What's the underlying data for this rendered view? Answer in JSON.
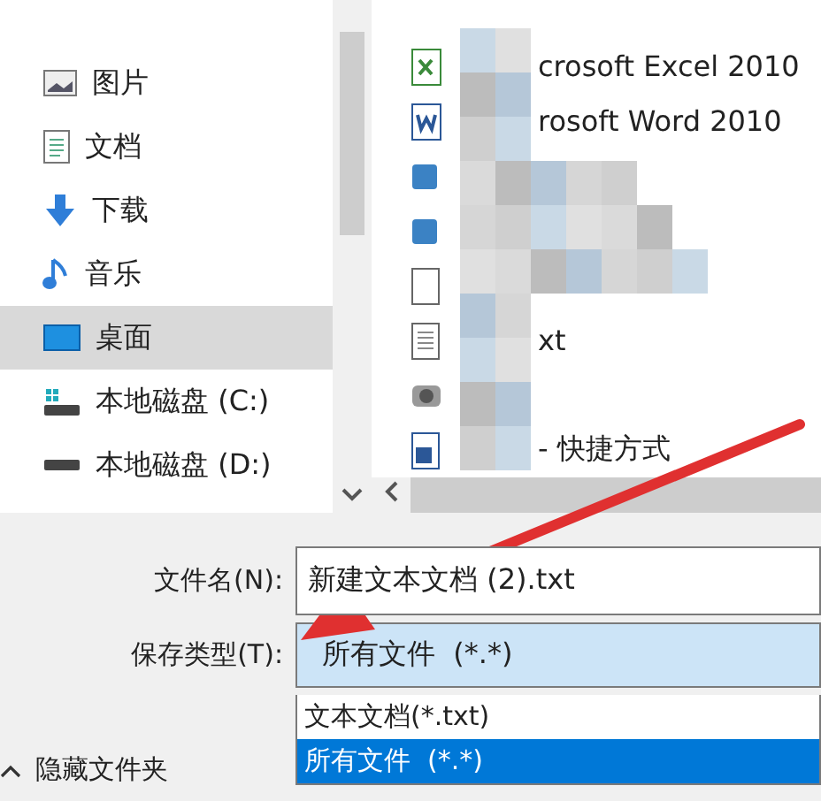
{
  "nav": {
    "items": [
      {
        "label": "图片",
        "selected": false
      },
      {
        "label": "文档",
        "selected": false
      },
      {
        "label": "下载",
        "selected": false
      },
      {
        "label": "音乐",
        "selected": false
      },
      {
        "label": "桌面",
        "selected": true
      },
      {
        "label": "本地磁盘 (C:)",
        "selected": false
      },
      {
        "label": "本地磁盘 (D:)",
        "selected": false
      }
    ]
  },
  "files": {
    "items": [
      {
        "kind": "excel",
        "name": "crosoft Excel 2010"
      },
      {
        "kind": "word",
        "name": "rosoft Word 2010"
      },
      {
        "kind": "app"
      },
      {
        "kind": "app"
      },
      {
        "kind": "blank"
      },
      {
        "kind": "text",
        "name": "xt"
      },
      {
        "kind": "camera"
      },
      {
        "kind": "shortcut",
        "name": "- 快捷方式"
      }
    ]
  },
  "filename": {
    "label": "文件名(N):",
    "value": "新建文本文档 (2).txt"
  },
  "save_type": {
    "label": "保存类型(T):",
    "value": "所有文件  (*.*)",
    "expanded": true,
    "options": [
      {
        "label": "文本文档(*.txt)",
        "selected": false
      },
      {
        "label": "所有文件  (*.*)",
        "selected": true
      }
    ]
  },
  "hide_folders": {
    "label": "隐藏文件夹"
  }
}
